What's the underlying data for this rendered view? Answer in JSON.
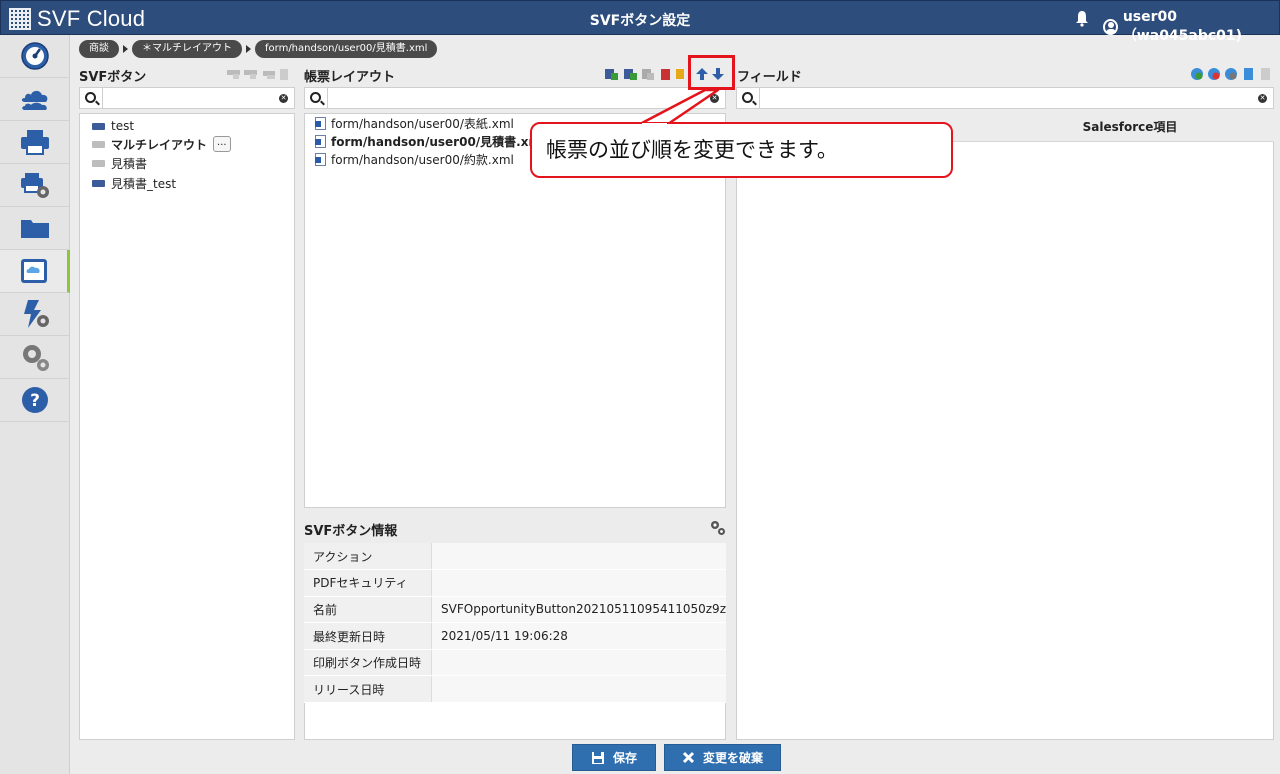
{
  "header": {
    "app_name": "SVF Cloud",
    "title": "SVFボタン設定",
    "user": "user00（wa045abc01)"
  },
  "breadcrumb": [
    "商談",
    "＊マルチレイアウト",
    "form/handson/user00/見積書.xml"
  ],
  "svf_buttons": {
    "title": "SVFボタン",
    "search_placeholder": "",
    "items": [
      {
        "label": "test",
        "color": "#3d5a99"
      },
      {
        "label": "マルチレイアウト",
        "color": "#bdbdbd",
        "more": "..."
      },
      {
        "label": "見積書",
        "color": "#bdbdbd"
      },
      {
        "label": "見積書_test",
        "color": "#3d5a99"
      }
    ]
  },
  "layouts": {
    "title": "帳票レイアウト",
    "search_placeholder": "",
    "items": [
      "form/handson/user00/表紙.xml",
      "form/handson/user00/見積書.xml",
      "form/handson/user00/約款.xml"
    ]
  },
  "callout": {
    "text": "帳票の並び順を変更できます。",
    "color": "#e3141b"
  },
  "info": {
    "title": "SVFボタン情報",
    "rows": [
      {
        "key": "アクション",
        "value": ""
      },
      {
        "key": "PDFセキュリティ",
        "value": ""
      },
      {
        "key": "名前",
        "value": "SVFOpportunityButton20210511095411050z9z"
      },
      {
        "key": "最終更新日時",
        "value": "2021/05/11 19:06:28"
      },
      {
        "key": "印刷ボタン作成日時",
        "value": ""
      },
      {
        "key": "リリース日時",
        "value": ""
      }
    ]
  },
  "fields": {
    "title": "フィールド",
    "search_placeholder": "",
    "column_header": "Salesforce項目"
  },
  "footer": {
    "save_label": "保存",
    "discard_label": "変更を破棄"
  },
  "colors": {
    "header_bg": "#2d4d7c",
    "accent_blue": "#2f6fb0",
    "nav_active": "#8cc63f"
  }
}
